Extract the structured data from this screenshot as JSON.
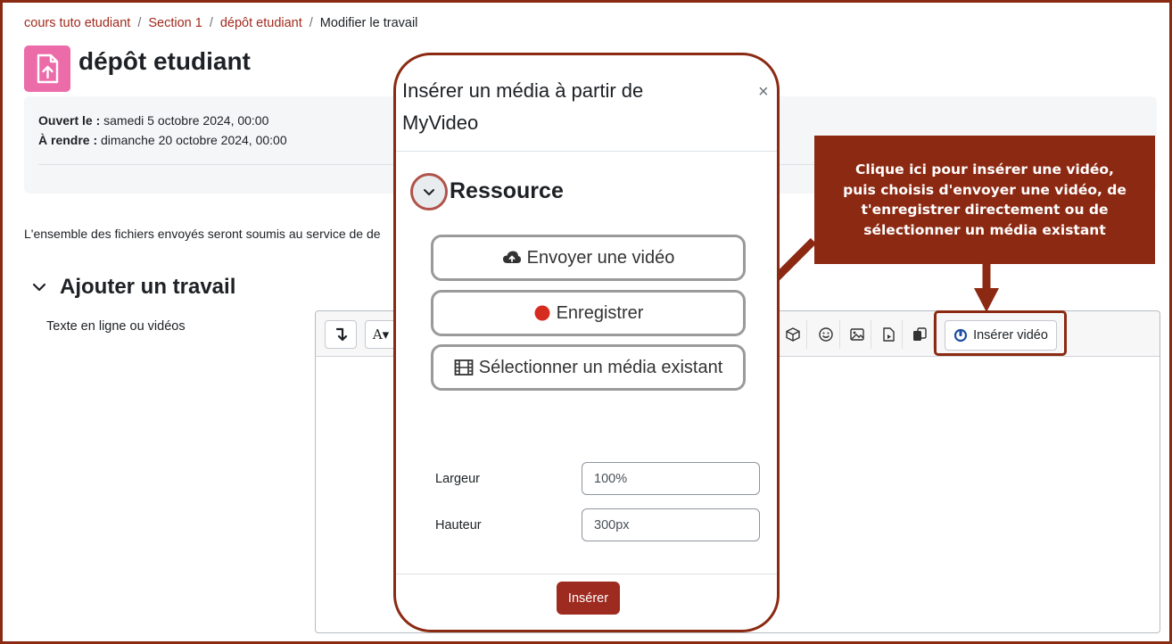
{
  "breadcrumb": {
    "items": [
      "cours tuto etudiant",
      "Section 1",
      "dépôt etudiant"
    ],
    "current": "Modifier le travail",
    "separator": "/"
  },
  "page": {
    "title": "dépôt etudiant",
    "icon": "file-upload-icon"
  },
  "dates": {
    "open_label": "Ouvert le :",
    "open_value": "samedi 5 octobre 2024, 00:00",
    "due_label": "À rendre :",
    "due_value": "dimanche 20 octobre 2024, 00:00"
  },
  "info_text": "L'ensemble des fichiers envoyés seront soumis au service de de",
  "section": {
    "title": "Ajouter un travail",
    "field_label": "Texte en ligne ou vidéos"
  },
  "editor": {
    "insert_video_label": "Insérer vidéo"
  },
  "modal": {
    "title_line1": "Insérer un média à partir de",
    "title_line2": "MyVideo",
    "close": "×",
    "resource_title": "Ressource",
    "upload_label": "Envoyer une vidéo",
    "record_label": "Enregistrer",
    "select_label": "Sélectionner un média existant",
    "width_label": "Largeur",
    "width_value": "100%",
    "height_label": "Hauteur",
    "height_value": "300px",
    "insert_label": "Insérer"
  },
  "callout": {
    "text": "Clique ici pour insérer une vidéo, puis choisis d'envoyer une vidéo, de t'enregistrer directement ou de sélectionner un média existant"
  },
  "colors": {
    "accent": "#8c2912",
    "link": "#a12b1e",
    "record_dot": "#d62c1f",
    "page_icon": "#ec6ba9"
  }
}
